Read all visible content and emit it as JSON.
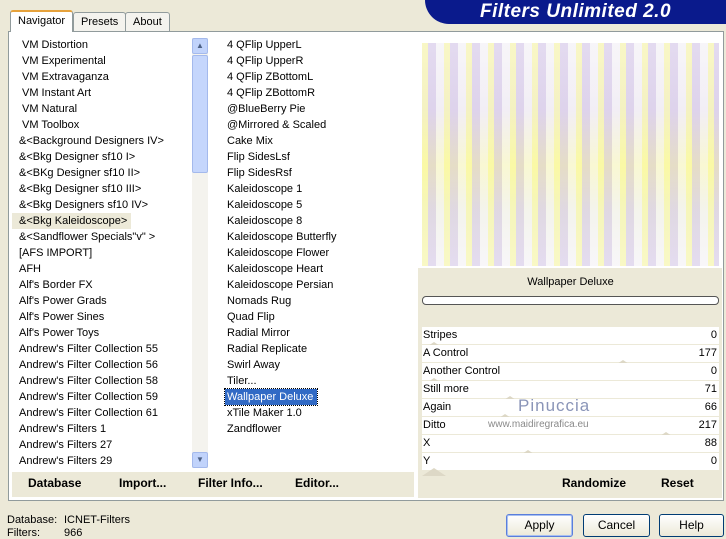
{
  "banner": "Filters Unlimited 2.0",
  "tabs": [
    "Navigator",
    "Presets",
    "About"
  ],
  "categories": [
    "VM Distortion",
    "VM Experimental",
    "VM Extravaganza",
    "VM Instant Art",
    "VM Natural",
    "VM Toolbox",
    "&<Background Designers IV>",
    "&<Bkg Designer sf10 I>",
    "&<BKg Designer sf10 II>",
    "&<Bkg Designer sf10 III>",
    "&<Bkg Designers sf10 IV>",
    "&<Bkg Kaleidoscope>",
    "&<Sandflower Specials\"v\" >",
    "[AFS IMPORT]",
    "AFH",
    "Alf's Border FX",
    "Alf's Power Grads",
    "Alf's Power Sines",
    "Alf's Power Toys",
    "Andrew's Filter Collection 55",
    "Andrew's Filter Collection 56",
    "Andrew's Filter Collection 58",
    "Andrew's Filter Collection 59",
    "Andrew's Filter Collection 61",
    "Andrew's Filters 1",
    "Andrew's Filters 27",
    "Andrew's Filters 29"
  ],
  "selected_category": "&<Bkg Kaleidoscope>",
  "filters": [
    "4 QFlip UpperL",
    "4 QFlip UpperR",
    "4 QFlip ZBottomL",
    "4 QFlip ZBottomR",
    "@BlueBerry Pie",
    "@Mirrored & Scaled",
    "Cake Mix",
    "Flip SidesLsf",
    "Flip SidesRsf",
    "Kaleidoscope 1",
    "Kaleidoscope 5",
    "Kaleidoscope 8",
    "Kaleidoscope Butterfly",
    "Kaleidoscope Flower",
    "Kaleidoscope Heart",
    "Kaleidoscope Persian",
    "Nomads Rug",
    "Quad Flip",
    "Radial Mirror",
    "Radial Replicate",
    "Swirl Away",
    "Tiler...",
    "Wallpaper Deluxe",
    "xTile Maker 1.0",
    "Zandflower"
  ],
  "selected_filter": "Wallpaper Deluxe",
  "bottom_buttons": [
    "Database",
    "Import...",
    "Filter Info...",
    "Editor..."
  ],
  "preview_title": "Wallpaper Deluxe",
  "slider_max": 255,
  "sliders": [
    {
      "label": "Stripes",
      "value": "0"
    },
    {
      "label": "A Control",
      "value": "177"
    },
    {
      "label": "Another Control",
      "value": "0"
    },
    {
      "label": "Still more",
      "value": "71"
    },
    {
      "label": "Again",
      "value": "66"
    },
    {
      "label": "Ditto",
      "value": "217"
    },
    {
      "label": "X",
      "value": "88"
    },
    {
      "label": "Y",
      "value": "0"
    }
  ],
  "randomize": "Randomize",
  "reset": "Reset",
  "status": {
    "database_label": "Database:",
    "database_value": "ICNET-Filters",
    "filters_label": "Filters:",
    "filters_value": "966"
  },
  "actions": [
    "Apply",
    "Cancel",
    "Help"
  ],
  "watermark": {
    "name": "Pinuccia",
    "url": "www.maidiregrafica.eu"
  }
}
